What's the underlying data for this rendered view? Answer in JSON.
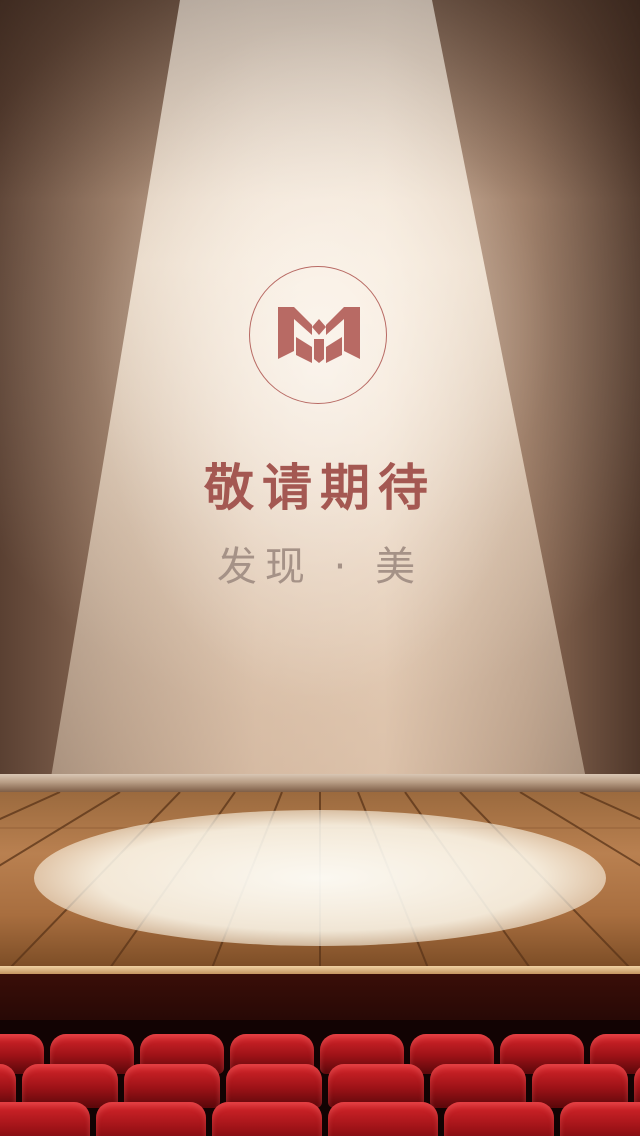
{
  "splash": {
    "logo_icon": "m-logo-icon",
    "title": "敬请期待",
    "subtitle": "发现 · 美"
  },
  "colors": {
    "title": "#a45852",
    "subtitle": "#a59287",
    "logo": "#b86a64",
    "seat": "#c81e24",
    "floor": "#b98050"
  },
  "scene": {
    "background_icon": "theater-stage-spotlight-illustration"
  }
}
